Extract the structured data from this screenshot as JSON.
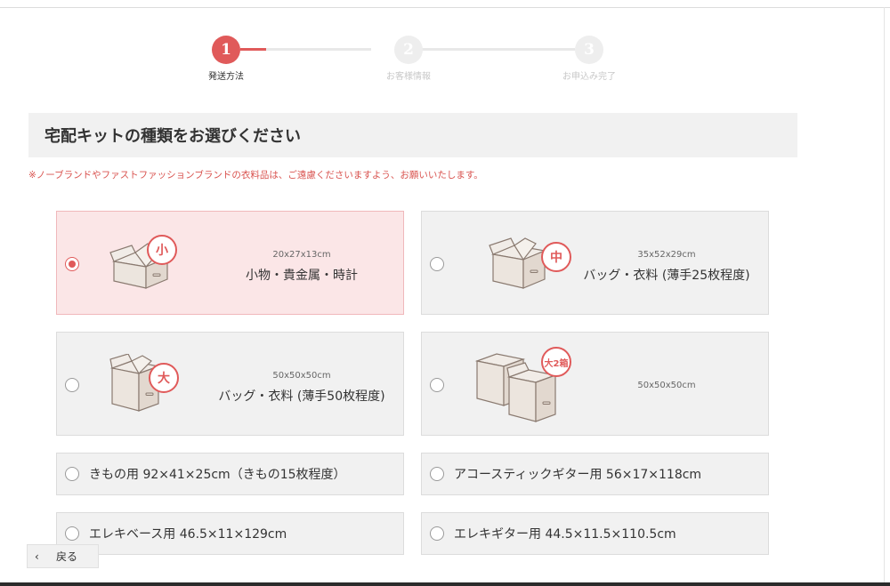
{
  "stepper": {
    "steps": [
      {
        "number": "1",
        "label": "発送方法",
        "active": true
      },
      {
        "number": "2",
        "label": "お客様情報",
        "active": false
      },
      {
        "number": "3",
        "label": "お申込み完了",
        "active": false
      }
    ]
  },
  "section": {
    "title": "宅配キットの種類をお選びください",
    "notice": "※ノーブランドやファストファッションブランドの衣料品は、ご遠慮くださいますよう、お願いいたします。"
  },
  "options": {
    "small": {
      "badge": "小",
      "dims": "20x27x13cm",
      "label": "小物・貴金属・時計",
      "selected": true
    },
    "medium": {
      "badge": "中",
      "dims": "35x52x29cm",
      "label": "バッグ・衣料 (薄手25枚程度)",
      "selected": false
    },
    "large": {
      "badge": "大",
      "dims": "50x50x50cm",
      "label": "バッグ・衣料 (薄手50枚程度)",
      "selected": false
    },
    "large2": {
      "badge": "大2箱",
      "dims": "50x50x50cm",
      "selected": false
    },
    "kimono": {
      "label": "きもの用 92×41×25cm（きもの15枚程度）",
      "selected": false
    },
    "acoustic": {
      "label": "アコースティックギター用 56×17×118cm",
      "selected": false
    },
    "ebass": {
      "label": "エレキベース用 46.5×11×129cm",
      "selected": false
    },
    "eguitar": {
      "label": "エレキギター用 44.5×11.5×110.5cm",
      "selected": false
    }
  },
  "nav": {
    "back_label": "戻る",
    "back_icon": "chevron-left-icon"
  },
  "colors": {
    "accent": "#e05a5a",
    "selected_bg": "#fbe6e7",
    "card_bg": "#f1f1f1",
    "notice": "#d9534f"
  }
}
